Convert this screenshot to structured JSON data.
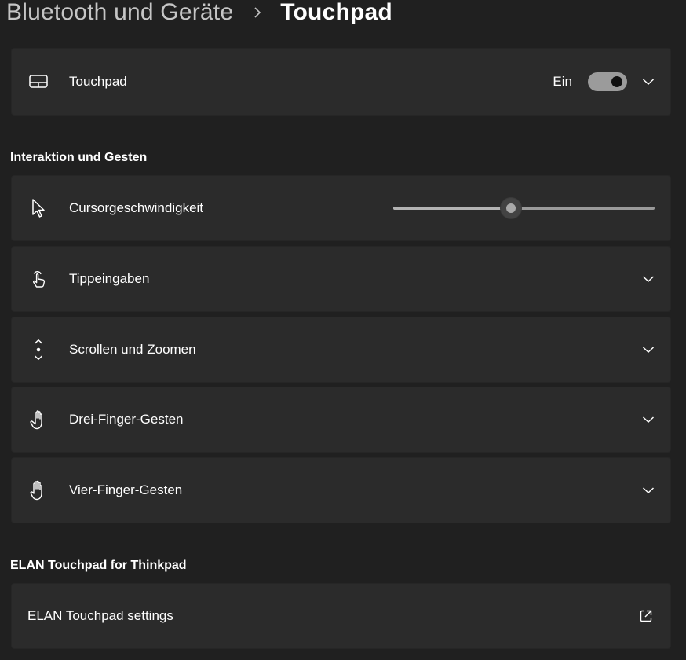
{
  "breadcrumb": {
    "parent": "Bluetooth und Geräte",
    "current": "Touchpad"
  },
  "touchpad_card": {
    "label": "Touchpad",
    "icon": "touchpad-icon",
    "toggle_state": "Ein",
    "toggle_on": true
  },
  "sections": {
    "interaction_title": "Interaktion und Gesten",
    "elan_title": "ELAN Touchpad for Thinkpad"
  },
  "cursor_speed": {
    "label": "Cursorgeschwindigkeit",
    "icon": "cursor-arrow-icon",
    "value_fraction": 0.45
  },
  "items": [
    {
      "label": "Tippeingaben",
      "icon": "tap-hand-icon"
    },
    {
      "label": "Scrollen und Zoomen",
      "icon": "scroll-arrows-icon"
    },
    {
      "label": "Drei-Finger-Gesten",
      "icon": "three-finger-hand-icon"
    },
    {
      "label": "Vier-Finger-Gesten",
      "icon": "four-finger-hand-icon"
    }
  ],
  "elan_card": {
    "label": "ELAN Touchpad settings",
    "icon": "external-link-icon"
  },
  "colors": {
    "background": "#202020",
    "card": "#2b2b2b",
    "toggle_track": "#9b9b9b"
  }
}
